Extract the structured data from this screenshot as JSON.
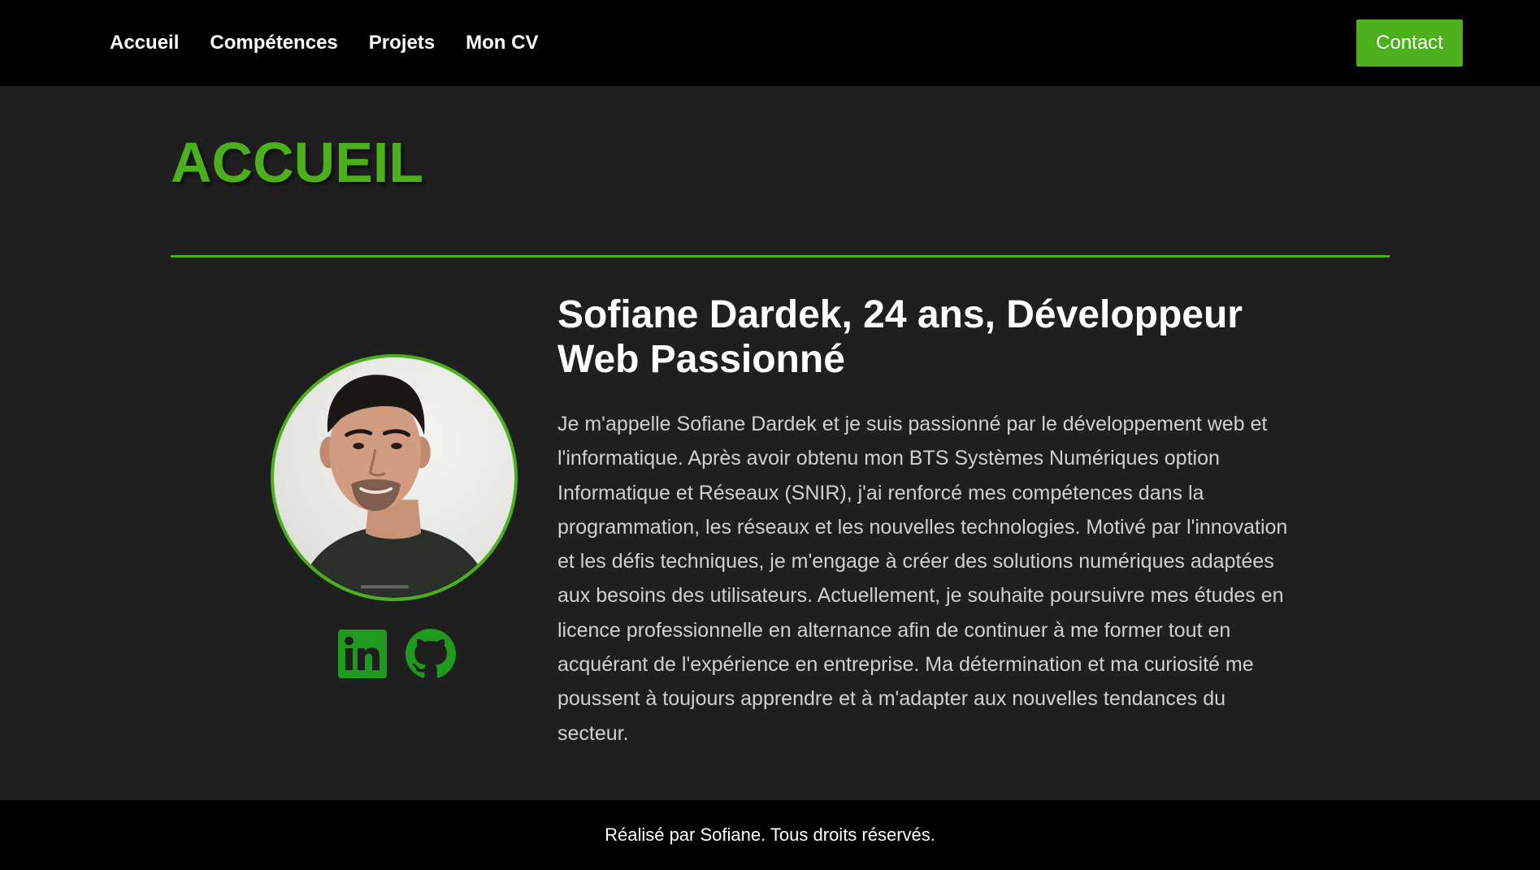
{
  "nav": {
    "items": [
      {
        "label": "Accueil"
      },
      {
        "label": "Compétences"
      },
      {
        "label": "Projets"
      },
      {
        "label": "Mon CV"
      }
    ],
    "contact_label": "Contact"
  },
  "main": {
    "title": "ACCUEIL",
    "headline": "Sofiane Dardek, 24 ans, Développeur Web Passionné",
    "bio": "Je m'appelle Sofiane Dardek et je suis passionné par le développement web et l'informatique. Après avoir obtenu mon BTS Systèmes Numériques option Informatique et Réseaux (SNIR), j'ai renforcé mes compétences dans la programmation, les réseaux et les nouvelles technologies. Motivé par l'innovation et les défis techniques, je m'engage à créer des solutions numériques adaptées aux besoins des utilisateurs. Actuellement, je souhaite poursuivre mes études en licence professionnelle en alternance afin de continuer à me former tout en acquérant de l'expérience en entreprise. Ma détermination et ma curiosité me poussent à toujours apprendre et à m'adapter aux nouvelles tendances du secteur.",
    "socials": [
      {
        "icon": "linkedin-icon"
      },
      {
        "icon": "github-icon"
      }
    ]
  },
  "footer": {
    "text": "Réalisé par Sofiane. Tous droits réservés."
  },
  "colors": {
    "accent": "#4caf1c",
    "social_icon": "#1f9a1f",
    "page_bg": "#1f1f1f",
    "bar_bg": "#000000"
  }
}
